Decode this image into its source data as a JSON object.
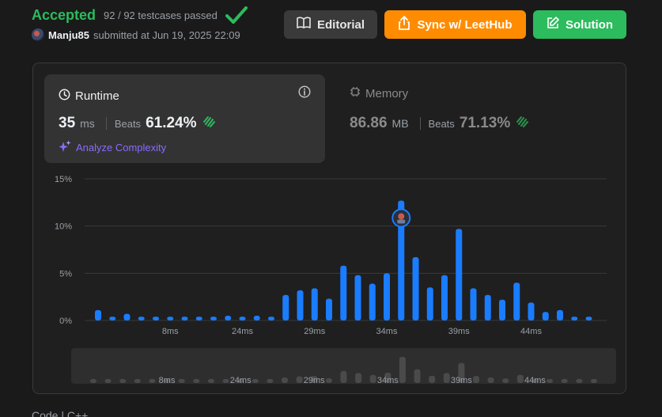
{
  "header": {
    "status": "Accepted",
    "testcases": "92 / 92 testcases passed",
    "username": "Manju85",
    "submitted_text": "submitted at Jun 19, 2025 22:09"
  },
  "buttons": {
    "editorial": "Editorial",
    "sync": "Sync w/ LeetHub",
    "solution": "Solution"
  },
  "runtime": {
    "title": "Runtime",
    "value": "35",
    "unit": "ms",
    "beats_label": "Beats",
    "beats_value": "61.24%",
    "analyze_label": "Analyze Complexity"
  },
  "memory": {
    "title": "Memory",
    "value": "86.86",
    "unit": "MB",
    "beats_label": "Beats",
    "beats_value": "71.13%"
  },
  "colors": {
    "accepted": "#2cbb5d",
    "bar": "#1a7cff",
    "sync_button": "#ff8c00",
    "solution_button": "#2cbb5d",
    "analyze": "#8a6bff"
  },
  "icons": {
    "check": "check-icon",
    "editorial": "book-icon",
    "sync": "upload-icon",
    "solution": "edit-icon",
    "runtime": "clock-icon",
    "memory": "chip-icon",
    "info": "info-icon",
    "beats": "clap-icon",
    "analyze": "sparkle-icon"
  },
  "chart_data": {
    "type": "bar",
    "title": "",
    "xlabel": "",
    "ylabel": "",
    "ylim": [
      0,
      15
    ],
    "y_ticks": [
      "15%",
      "10%",
      "5%",
      "0%"
    ],
    "x_tick_labels": [
      "8ms",
      "24ms",
      "29ms",
      "34ms",
      "39ms",
      "44ms"
    ],
    "values": [
      1.1,
      0.4,
      0.7,
      0.4,
      0.4,
      0.4,
      0.4,
      0.4,
      0.4,
      0.5,
      0.4,
      0.5,
      0.4,
      2.7,
      3.2,
      3.4,
      2.3,
      5.8,
      4.8,
      3.9,
      5.0,
      12.7,
      6.7,
      3.5,
      4.8,
      9.7,
      3.4,
      2.7,
      2.2,
      4.0,
      1.9,
      0.9,
      1.1,
      0.4,
      0.4
    ],
    "highlight_index": 21,
    "grid": true,
    "overview_tick_labels": [
      "8ms",
      "24ms",
      "29ms",
      "34ms",
      "39ms",
      "44ms"
    ]
  },
  "footer": {
    "code_label": "Code | C++"
  }
}
